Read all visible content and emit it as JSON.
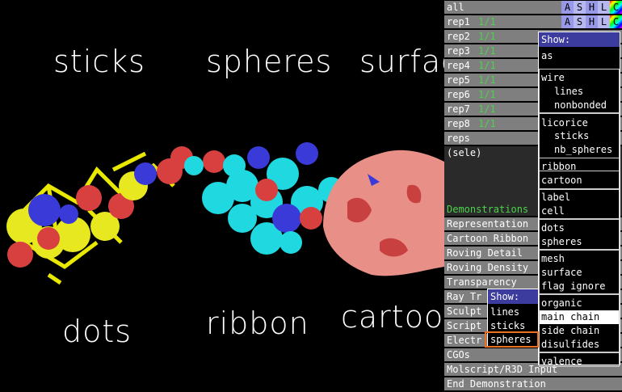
{
  "viewer": {
    "labels": {
      "sticks": "sticks",
      "spheres": "spheres",
      "surface": "surface",
      "dots": "dots",
      "ribbon": "ribbon",
      "cartoon": "cartoon"
    }
  },
  "objects": [
    {
      "name": "all",
      "count": "",
      "buttons": [
        "A",
        "S",
        "H",
        "L",
        "C"
      ]
    },
    {
      "name": "rep1",
      "count": "1/1",
      "buttons": [
        "A",
        "S",
        "H",
        "L",
        "C"
      ]
    },
    {
      "name": "rep2",
      "count": "1/1",
      "buttons": []
    },
    {
      "name": "rep3",
      "count": "1/1",
      "buttons": []
    },
    {
      "name": "rep4",
      "count": "1/1",
      "buttons": []
    },
    {
      "name": "rep5",
      "count": "1/1",
      "buttons": []
    },
    {
      "name": "rep6",
      "count": "1/1",
      "buttons": []
    },
    {
      "name": "rep7",
      "count": "1/1",
      "buttons": []
    },
    {
      "name": "rep8",
      "count": "1/1",
      "buttons": []
    },
    {
      "name": "reps",
      "count": "",
      "buttons": []
    },
    {
      "name": "(sele)",
      "count": "",
      "buttons": []
    }
  ],
  "demo": {
    "header": "Demonstrations",
    "items": [
      "Representation",
      "Cartoon Ribbon",
      "Roving Detail",
      "Roving Density",
      "Transparency",
      "Ray Tr",
      "Sculpt",
      "Script",
      "Electr",
      "CGOs",
      "Molscript/R3D Input",
      "End Demonstration"
    ]
  },
  "show_menu_main": {
    "title": "Show:",
    "items": [
      "as",
      "wire",
      "lines",
      "nonbonded",
      "licorice",
      "sticks",
      "nb_spheres",
      "ribbon",
      "cartoon",
      "label",
      "cell",
      "dots",
      "spheres",
      "mesh",
      "surface",
      "flag ignore",
      "organic",
      "main chain",
      "side chain",
      "disulfides",
      "valence"
    ]
  },
  "show_menu_sub": {
    "title": "Show:",
    "items": [
      "lines",
      "sticks",
      "spheres"
    ]
  },
  "colors": {
    "accent_green": "#4cd34c",
    "menu_title": "#3c3c9e",
    "highlight_box": "#e87020"
  }
}
